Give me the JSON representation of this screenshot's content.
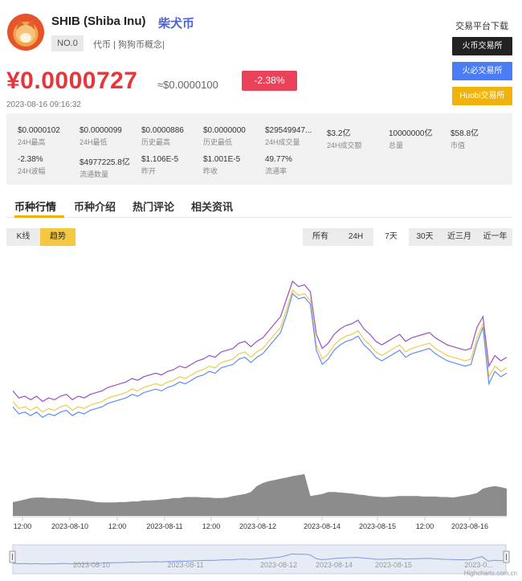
{
  "header": {
    "coin_name": "SHIB (Shiba Inu)",
    "coin_cn": "柴犬币",
    "rank": "NO.0",
    "tags": "代币 | 狗狗币概念|",
    "price": "¥0.0000727",
    "price_usd": "≈$0.0000100",
    "change": "-2.38%",
    "timestamp": "2023-08-16 09:16:32"
  },
  "exchanges": {
    "title": "交易平台下载",
    "items": [
      "火币交易所",
      "火必交易所",
      "Huobi交易所"
    ]
  },
  "stats": [
    {
      "value": "$0.0000102",
      "label": "24H最高"
    },
    {
      "value": "$0.0000099",
      "label": "24H最低"
    },
    {
      "value": "$0.0000886",
      "label": "历史最高"
    },
    {
      "value": "$0.0000000",
      "label": "历史最低"
    },
    {
      "value": "$29549947...",
      "label": "24H成交量"
    },
    {
      "value": "$3.2亿",
      "label": "24H成交额"
    },
    {
      "value": "10000000亿",
      "label": "总量"
    },
    {
      "value": "$58.8亿",
      "label": "市值"
    },
    {
      "value": "-2.38%",
      "label": "24H波幅"
    },
    {
      "value": "$4977225.8亿",
      "label": "流通数量"
    },
    {
      "value": "$1.106E-5",
      "label": "昨开"
    },
    {
      "value": "$1.001E-5",
      "label": "昨收"
    },
    {
      "value": "49.77%",
      "label": "流通率"
    }
  ],
  "tabs": [
    "币种行情",
    "币种介绍",
    "热门评论",
    "相关资讯"
  ],
  "view_toggle": [
    "K线",
    "趋势"
  ],
  "ranges": [
    "所有",
    "24H",
    "7天",
    "30天",
    "近三月",
    "近一年"
  ],
  "colors": {
    "purple": "#9b4fc4",
    "yellow": "#f2c94c",
    "blue": "#5b8ff9",
    "volume": "#8c8c8c",
    "red": "#e5363b",
    "accent": "#f0b20c"
  },
  "chart_data": {
    "type": "line",
    "x_ticks": [
      "12:00",
      "2023-08-10",
      "12:00",
      "2023-08-11",
      "12:00",
      "2023-08-12",
      "2023-08-14",
      "2023-08-15",
      "12:00",
      "2023-08-16"
    ],
    "navigator_ticks": [
      "2023-08-10",
      "2023-08-11",
      "2023-08-12",
      "2023-08-14",
      "2023-08-15",
      "2023-0..."
    ],
    "credit": "Highcharts.com.cn",
    "series": [
      {
        "color": "#9b4fc4",
        "values": [
          38,
          34,
          35,
          33,
          35,
          32,
          34,
          33,
          35,
          36,
          33,
          35,
          34,
          36,
          37,
          38,
          40,
          41,
          42,
          43,
          45,
          44,
          46,
          47,
          48,
          47,
          49,
          50,
          52,
          51,
          53,
          55,
          56,
          58,
          57,
          60,
          61,
          62,
          65,
          66,
          63,
          66,
          68,
          72,
          76,
          80,
          90,
          100,
          97,
          98,
          94,
          70,
          62,
          65,
          70,
          73,
          75,
          76,
          78,
          73,
          70,
          66,
          64,
          66,
          68,
          70,
          66,
          68,
          69,
          70,
          71,
          68,
          66,
          64,
          63,
          62,
          61,
          62,
          74,
          80,
          52,
          58,
          55,
          57
        ]
      },
      {
        "color": "#f2c94c",
        "values": [
          32,
          28,
          29,
          27,
          29,
          26,
          28,
          27,
          29,
          30,
          27,
          29,
          28,
          30,
          31,
          32,
          34,
          35,
          36,
          37,
          39,
          38,
          40,
          41,
          42,
          41,
          43,
          44,
          46,
          45,
          47,
          49,
          50,
          52,
          51,
          54,
          55,
          56,
          59,
          60,
          57,
          60,
          62,
          66,
          70,
          74,
          84,
          95,
          92,
          93,
          89,
          64,
          56,
          59,
          64,
          67,
          69,
          70,
          72,
          67,
          64,
          60,
          58,
          60,
          62,
          64,
          60,
          62,
          63,
          64,
          65,
          62,
          60,
          58,
          57,
          56,
          55,
          56,
          68,
          76,
          46,
          52,
          49,
          51
        ]
      },
      {
        "color": "#5b8ff9",
        "values": [
          29,
          25,
          26,
          24,
          26,
          23,
          25,
          24,
          26,
          27,
          24,
          26,
          25,
          27,
          28,
          29,
          31,
          32,
          33,
          34,
          36,
          35,
          37,
          38,
          39,
          38,
          40,
          41,
          43,
          42,
          44,
          46,
          47,
          49,
          48,
          51,
          52,
          53,
          56,
          57,
          54,
          57,
          59,
          63,
          67,
          71,
          81,
          93,
          90,
          91,
          87,
          61,
          53,
          56,
          61,
          64,
          66,
          67,
          69,
          64,
          61,
          57,
          55,
          57,
          59,
          61,
          57,
          59,
          60,
          61,
          62,
          59,
          57,
          55,
          54,
          53,
          52,
          53,
          65,
          74,
          42,
          49,
          46,
          48
        ]
      }
    ],
    "volume": [
      28,
      30,
      33,
      36,
      37,
      37,
      36,
      36,
      35,
      35,
      34,
      33,
      32,
      30,
      28,
      27,
      27,
      27,
      28,
      28,
      29,
      29,
      31,
      31,
      32,
      33,
      34,
      36,
      36,
      38,
      38,
      38,
      37,
      37,
      36,
      36,
      37,
      40,
      42,
      44,
      48,
      60,
      66,
      70,
      72,
      75,
      77,
      80,
      82,
      84,
      40,
      42,
      44,
      48,
      48,
      47,
      46,
      45,
      43,
      42,
      40,
      39,
      38,
      38,
      39,
      40,
      40,
      40,
      40,
      39,
      39,
      39,
      38,
      38,
      37,
      39,
      41,
      43,
      46,
      55,
      58,
      60,
      58,
      55
    ],
    "grid": false,
    "legend": "none"
  }
}
